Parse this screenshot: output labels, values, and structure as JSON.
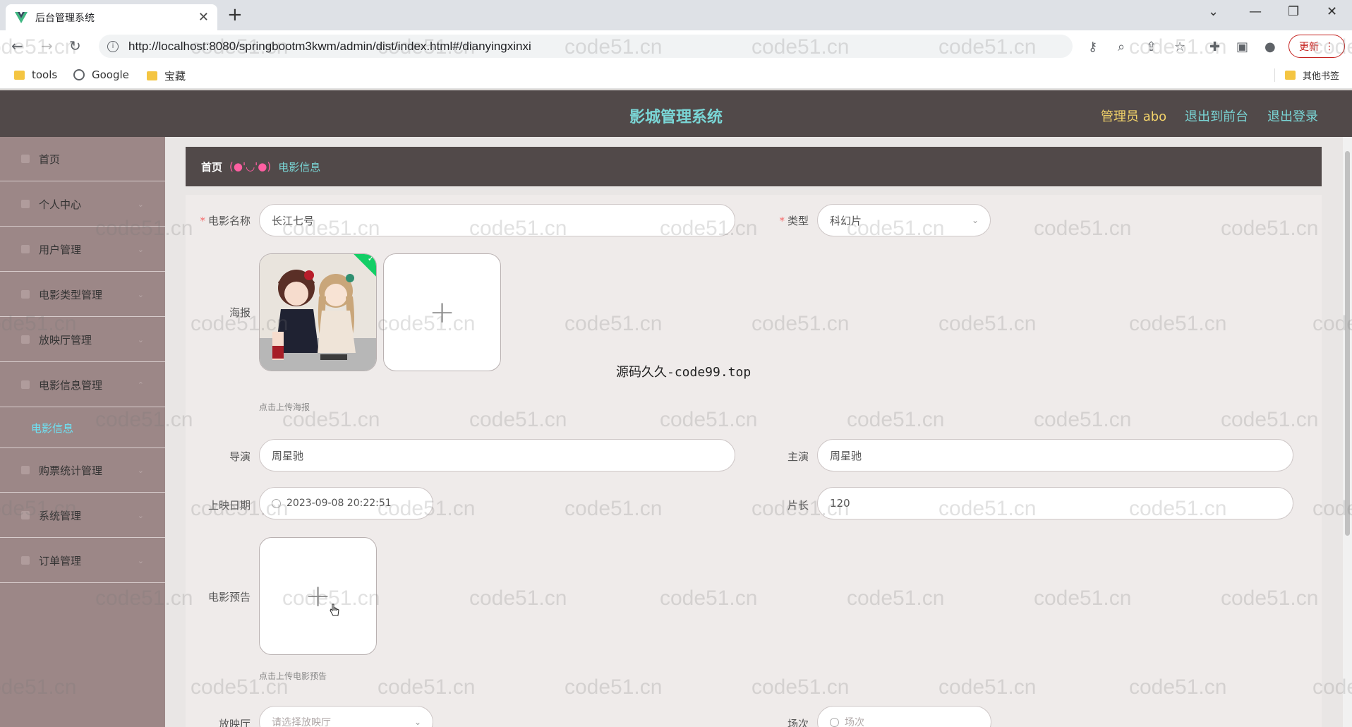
{
  "browser": {
    "tab_title": "后台管理系统",
    "url": "http://localhost:8080/springbootm3kwm/admin/dist/index.html#/dianyingxinxi",
    "update_label": "更新",
    "bookmarks": [
      "tools",
      "Google",
      "宝藏"
    ],
    "other_bookmarks": "其他书签"
  },
  "header": {
    "title": "影城管理系统",
    "admin_label": "管理员 abo",
    "back_front_label": "退出到前台",
    "logout_label": "退出登录",
    "title_color": "#7ad6d6",
    "admin_color": "#f3d36a"
  },
  "sidebar": {
    "items": [
      {
        "label": "首页"
      },
      {
        "label": "个人中心"
      },
      {
        "label": "用户管理"
      },
      {
        "label": "电影类型管理"
      },
      {
        "label": "放映厅管理"
      },
      {
        "label": "电影信息管理"
      },
      {
        "label": "购票统计管理"
      },
      {
        "label": "系统管理"
      },
      {
        "label": "订单管理"
      }
    ],
    "active_subitem": "电影信息"
  },
  "breadcrumb": {
    "home": "首页",
    "separator": "(●'◡'●)",
    "current": "电影信息"
  },
  "form": {
    "name": {
      "label": "电影名称",
      "value": "长江七号"
    },
    "type": {
      "label": "类型",
      "value": "科幻片"
    },
    "poster": {
      "label": "海报",
      "tip": "点击上传海报"
    },
    "director": {
      "label": "导演",
      "value": "周星驰"
    },
    "actor": {
      "label": "主演",
      "value": "周星驰"
    },
    "release_date": {
      "label": "上映日期",
      "value": "2023-09-08 20:22:51"
    },
    "duration": {
      "label": "片长",
      "value": "120"
    },
    "trailer": {
      "label": "电影预告",
      "tip": "点击上传电影预告"
    },
    "hall": {
      "label": "放映厅",
      "placeholder": "请选择放映厅"
    },
    "session": {
      "label": "场次",
      "placeholder": "场次"
    }
  },
  "overlay_caption": "源码久久-code99.top",
  "watermark_text": "code51.cn"
}
